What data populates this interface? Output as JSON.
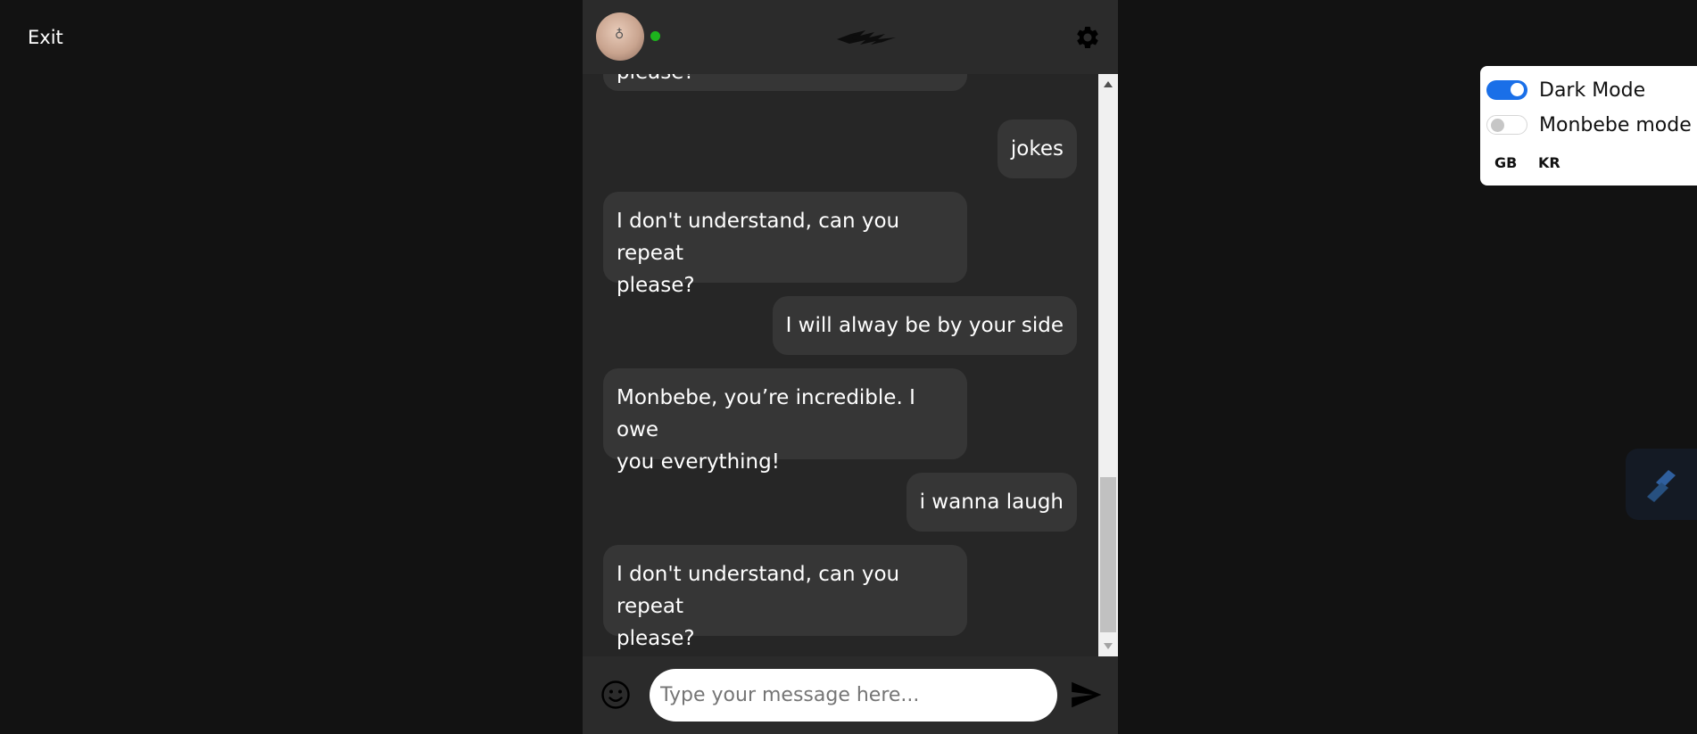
{
  "exit_label": "Exit",
  "chat": {
    "status": "online",
    "messages": [
      {
        "sender": "bot",
        "lines": [
          "please?"
        ]
      },
      {
        "sender": "user",
        "lines": [
          "jokes"
        ]
      },
      {
        "sender": "bot",
        "lines": [
          "I don't understand, can you repeat",
          "please?"
        ]
      },
      {
        "sender": "user",
        "lines": [
          "I will alway be by your side"
        ]
      },
      {
        "sender": "bot",
        "lines": [
          "Monbebe, you’re incredible. I owe",
          "you everything!"
        ]
      },
      {
        "sender": "user",
        "lines": [
          "i wanna laugh"
        ]
      },
      {
        "sender": "bot",
        "lines": [
          "I don't understand, can you repeat",
          "please?"
        ]
      }
    ],
    "input_placeholder": "Type your message here..."
  },
  "settings": {
    "dark_mode": {
      "label": "Dark Mode",
      "on": true
    },
    "monbebe_mode": {
      "label": "Monbebe mode",
      "on": false
    },
    "languages": [
      "GB",
      "KR"
    ]
  },
  "colors": {
    "page_bg": "#121212",
    "chat_bg": "#262626",
    "bubble_bg": "#363636",
    "toggle_accent": "#1a6fe8",
    "online": "#1db41d"
  },
  "icons": {
    "settings": "gear-icon",
    "emoji": "smiley-icon",
    "send": "send-arrow-icon",
    "logo": "band-logo-icon",
    "widget": "slash-widget-icon"
  }
}
